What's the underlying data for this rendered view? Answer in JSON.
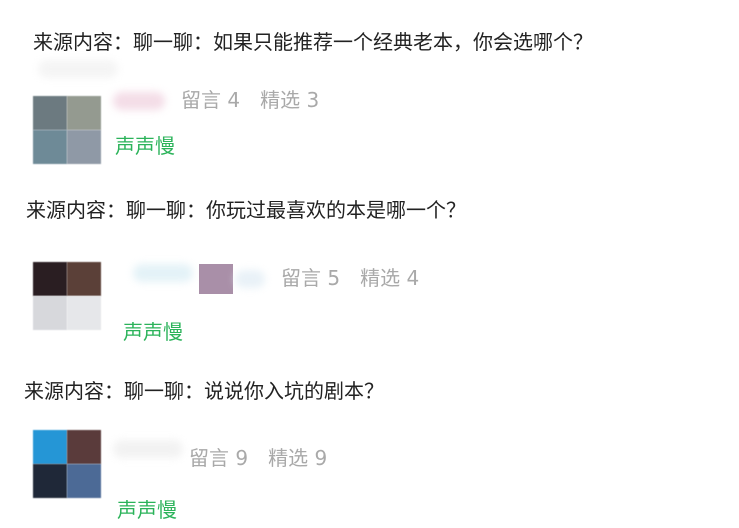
{
  "entries": [
    {
      "source_prefix": "来源内容：",
      "topic_prefix": "聊一聊：",
      "question": "如果只能推荐一个经典老本，你会选哪个？",
      "meta_comment_label": "留言 4",
      "meta_pick_label": "精选 3",
      "author": "声声慢",
      "avatar_colors": [
        "#6c7a80",
        "#949a90",
        "#6e8a97",
        "#8f99a6"
      ],
      "blur_color": "#f2d7e3"
    },
    {
      "source_prefix": "来源内容：",
      "topic_prefix": "聊一聊：",
      "question": "你玩过最喜欢的本是哪一个？",
      "meta_comment_label": "留言 5",
      "meta_pick_label": "精选 4",
      "author": "声声慢",
      "avatar_colors": [
        "#2a1e22",
        "#5b4038",
        "#d7d8dc",
        "#e6e7ea"
      ],
      "blur_color": "#dff0f6",
      "mosaic_color": "#a98fa8"
    },
    {
      "source_prefix": "来源内容：",
      "topic_prefix": "聊一聊：",
      "question": "说说你入坑的剧本？",
      "meta_comment_label": "留言 9",
      "meta_pick_label": "精选 9",
      "author": "声声慢",
      "avatar_colors": [
        "#2596d6",
        "#5a3b3b",
        "#1f2838",
        "#4c6a96"
      ],
      "blur_color": "#f0f0f0"
    }
  ],
  "colors": {
    "author_green": "#2bb35a",
    "meta_gray": "#a9a9a9",
    "text_dark": "#222222"
  }
}
